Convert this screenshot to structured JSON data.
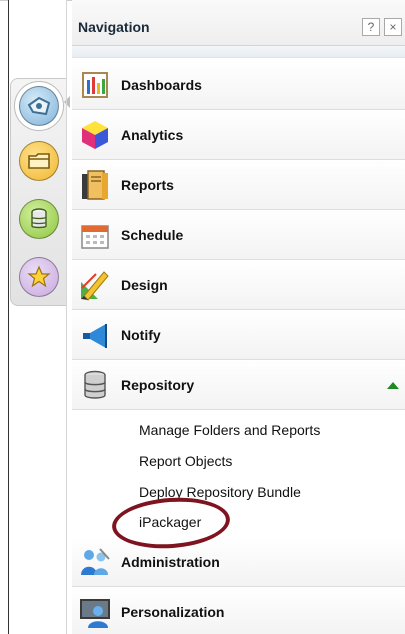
{
  "panel": {
    "title": "Navigation",
    "help_label": "?",
    "close_label": "×"
  },
  "rail": {
    "buttons": [
      {
        "icon": "home-icon",
        "color": "#7fb2d9",
        "active": true
      },
      {
        "icon": "folder-icon",
        "color": "#f2b632",
        "active": false
      },
      {
        "icon": "database-icon",
        "color": "#8cc63e",
        "active": false
      },
      {
        "icon": "star-icon",
        "color": "#c9a8e0",
        "active": false
      }
    ]
  },
  "nav": {
    "items": [
      {
        "label": "Dashboards",
        "icon": "dashboard-chart-icon"
      },
      {
        "label": "Analytics",
        "icon": "cube-icon"
      },
      {
        "label": "Reports",
        "icon": "report-books-icon"
      },
      {
        "label": "Schedule",
        "icon": "calendar-icon"
      },
      {
        "label": "Design",
        "icon": "design-pencil-icon"
      },
      {
        "label": "Notify",
        "icon": "megaphone-icon"
      },
      {
        "label": "Repository",
        "icon": "repository-stack-icon",
        "expanded": true
      },
      {
        "label": "Administration",
        "icon": "admin-users-icon"
      },
      {
        "label": "Personalization",
        "icon": "personalization-monitor-icon"
      }
    ],
    "repository_children": [
      "Manage Folders and Reports",
      "Report Objects",
      "Deploy Repository Bundle",
      "iPackager"
    ]
  },
  "colors": {
    "highlight_ring": "#7d1420",
    "expand_arrow": "#1d8a22"
  }
}
